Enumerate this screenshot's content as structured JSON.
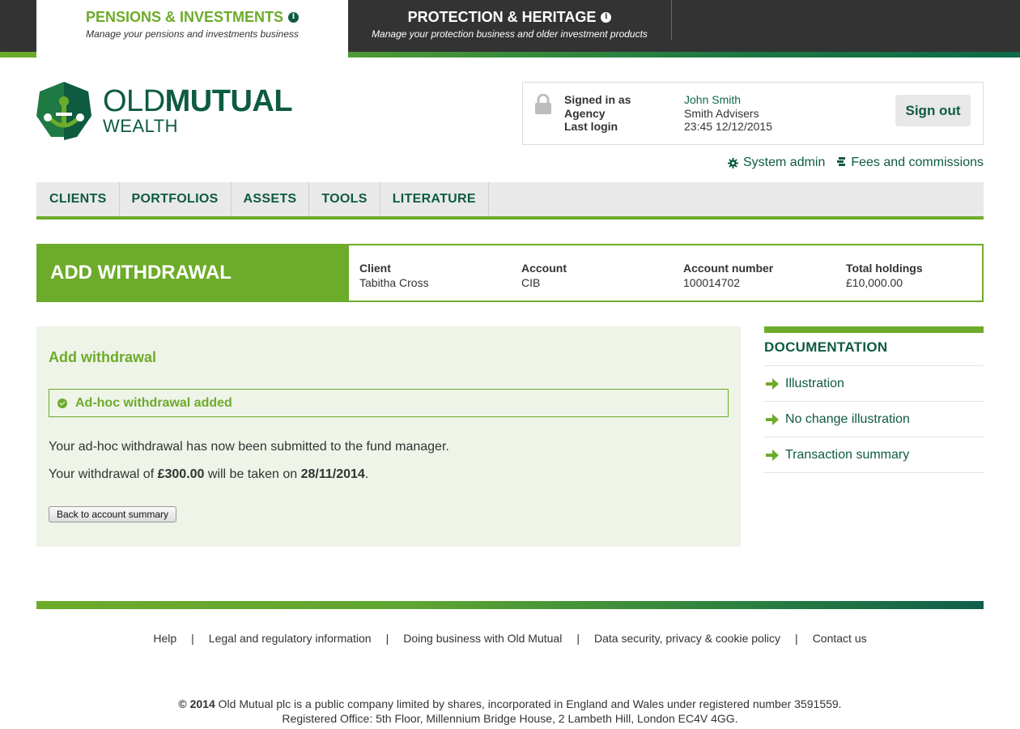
{
  "top_tabs": {
    "pensions": {
      "title": "PENSIONS & INVESTMENTS",
      "subtitle": "Manage your pensions and investments business"
    },
    "protection": {
      "title": "PROTECTION & HERITAGE",
      "subtitle": "Manage your protection business and older investment products"
    }
  },
  "brand": {
    "line1_light": "OLD",
    "line1_bold": "MUTUAL",
    "line2": "WEALTH"
  },
  "signin": {
    "labels": [
      "Signed in as",
      "Agency",
      "Last login"
    ],
    "user": "John Smith",
    "agency": "Smith Advisers",
    "last_login": "23:45 12/12/2015",
    "signout_label": "Sign out"
  },
  "utility": {
    "system_admin": "System admin",
    "fees": "Fees and commissions"
  },
  "nav": [
    "CLIENTS",
    "PORTFOLIOS",
    "ASSETS",
    "TOOLS",
    "LITERATURE"
  ],
  "page": {
    "title": "ADD WITHDRAWAL",
    "info": [
      {
        "label": "Client",
        "value": "Tabitha Cross"
      },
      {
        "label": "Account",
        "value": "CIB"
      },
      {
        "label": "Account number",
        "value": "100014702"
      },
      {
        "label": "Total holdings",
        "value": "£10,000.00"
      }
    ]
  },
  "main": {
    "heading": "Add withdrawal",
    "alert": "Ad-hoc withdrawal added",
    "message1": "Your ad-hoc withdrawal has now been submitted to the fund manager.",
    "message2_pre": "Your withdrawal of ",
    "amount": "£300.00",
    "message2_mid": " will be taken on ",
    "date": "28/11/2014",
    "message2_post": ".",
    "back_label": "Back to account summary"
  },
  "documentation": {
    "title": "DOCUMENTATION",
    "items": [
      "Illustration",
      "No change illustration",
      "Transaction summary"
    ]
  },
  "footer": {
    "links": [
      "Help",
      "Legal and regulatory information",
      "Doing business with Old Mutual",
      "Data security, privacy & cookie policy",
      "Contact us"
    ],
    "separator": "|",
    "copyright_year": "© 2014",
    "copyright_text": " Old Mutual plc is a public company limited by shares, incorporated in England and Wales under registered number 3591559.",
    "registered_office": "Registered Office: 5th Floor, Millennium Bridge House, 2 Lambeth Hill, London EC4V 4GG."
  },
  "colors": {
    "green": "#6dab2a",
    "dark_green": "#0e5b40",
    "topbar": "#333333",
    "panel_bg": "#eef4e8"
  }
}
